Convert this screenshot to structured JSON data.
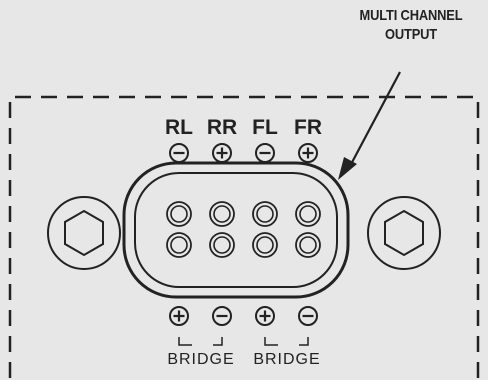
{
  "callout": {
    "line1": "MULTI CHANNEL",
    "line2": "OUTPUT"
  },
  "channels": [
    "RL",
    "RR",
    "FL",
    "FR"
  ],
  "top_polarity": [
    "minus",
    "plus",
    "minus",
    "plus"
  ],
  "bottom_polarity": [
    "plus",
    "minus",
    "plus",
    "minus"
  ],
  "bridge_labels": [
    "BRIDGE",
    "BRIDGE"
  ],
  "colors": {
    "background": "#e7e7e7",
    "line": "#222222"
  }
}
